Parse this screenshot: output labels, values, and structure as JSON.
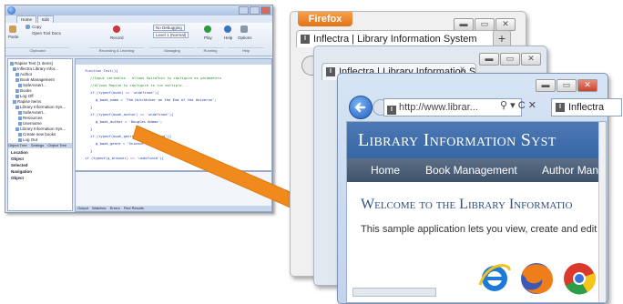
{
  "ide": {
    "tabs": [
      "Home",
      "Edit"
    ],
    "ribbon": {
      "groups": [
        "Clipboard",
        "Recording & Learning",
        "Managing",
        "Running",
        "Help"
      ],
      "buttons": [
        "Paste",
        "Copy",
        "Open Tool Docs",
        "Record",
        "Play",
        "Help",
        "Options"
      ],
      "dropdown_value": "No Debugging",
      "level_value": "Level 1 (Normal)"
    },
    "tree_items": [
      "Rapise Test (1 items)",
      "Inflectra Library Infor...",
      "Author",
      "Book Management",
      "SafeAssert...",
      "Books",
      "Log Off",
      "Rapise Items",
      "Library Information Sys...",
      "SafeAssert...",
      "Resources",
      "Username",
      "Library Information Sys...",
      "Create new books",
      "Log Out"
    ],
    "panel_tabs": [
      "Object Tree",
      "Settings",
      "Object Tree"
    ],
    "properties": [
      "Location",
      "Object",
      "Selected",
      "Navigation",
      "Object"
    ],
    "code_lines": [
      {
        "t": "function Test(){",
        "c": "k"
      },
      {
        "t": "//Input variables - allows SpiraTest to configure as parameters",
        "c": "c"
      },
      {
        "t": "//Allows Rapise to configure to run multiple...",
        "c": "c"
      },
      {
        "t": "if (typeof(book) == 'undefined'){",
        "c": "k"
      },
      {
        "t": "g_book_name = 'The Hitchhiker on the End of the Universe';",
        "c": ""
      },
      {
        "t": "}",
        "c": ""
      },
      {
        "t": "if (typeof(book_author) == 'undefined'){",
        "c": "k"
      },
      {
        "t": "g_book_author = 'Douglas Adams';",
        "c": ""
      },
      {
        "t": "}",
        "c": ""
      },
      {
        "t": "if (typeof(book_genre) == 'undefined'){",
        "c": "k"
      },
      {
        "t": "g_book_genre = 'Science Fiction';",
        "c": ""
      },
      {
        "t": "}",
        "c": ""
      },
      {
        "t": "if (typeof(g_browser) == 'undefined'){",
        "c": "k"
      }
    ],
    "lower_tabs": [
      "Output",
      "Watches",
      "Errors",
      "Find Results"
    ]
  },
  "browsers": {
    "firefox": {
      "menu_label": "Firefox",
      "tab_title": "Inflectra | Library Information System",
      "new_tab": "+"
    },
    "chrome": {
      "tab_title": "Inflectra | Library Information Sys",
      "tab_close": "x"
    },
    "ie": {
      "address": "http://www.librar...",
      "address_icons": "⚲ ▾ C ✕",
      "tab_title": "Inflectra",
      "site_title": "Library Information Syst",
      "nav": [
        "Home",
        "Book Management",
        "Author Mana"
      ],
      "welcome": "Welcome to the Library Informatio",
      "description": "This sample application lets you view, create and edit b"
    }
  },
  "colors": {
    "arrow": "#f08a1c",
    "ie_header": "#3e6da9",
    "firefox_orange": "#e8781c"
  },
  "icons": [
    "ie-logo-icon",
    "firefox-logo-icon",
    "chrome-logo-icon"
  ]
}
